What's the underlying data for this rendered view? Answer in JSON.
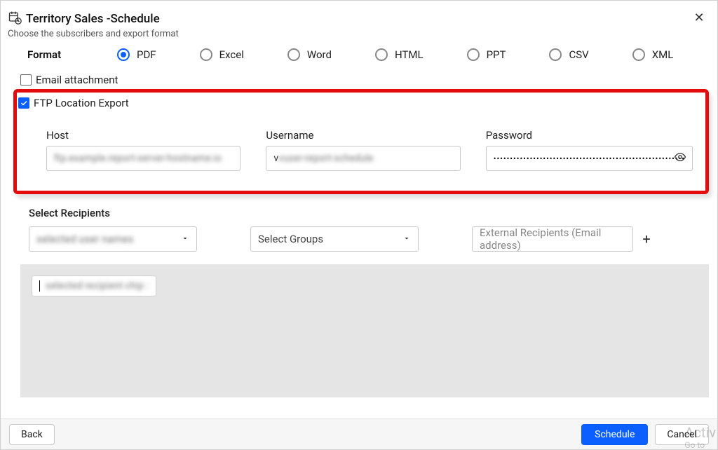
{
  "header": {
    "title": "Territory Sales -Schedule",
    "subtitle": "Choose the subscribers and export format"
  },
  "format": {
    "label": "Format",
    "options": [
      "PDF",
      "Excel",
      "Word",
      "HTML",
      "PPT",
      "CSV",
      "XML"
    ],
    "selected": "PDF"
  },
  "email_attachment": {
    "label": "Email attachment",
    "checked": false
  },
  "ftp": {
    "label": "FTP Location Export",
    "checked": true,
    "host_label": "Host",
    "host_value": "ftp.example.report-server-hostname.io",
    "username_label": "Username",
    "username_value": "vuser-report-schedule",
    "password_label": "Password",
    "password_masked": "••••••••••••••••••••••••••••••••••••••••••••••••••••••••••"
  },
  "recipients": {
    "section_label": "Select Recipients",
    "users_selected": "selected user names",
    "groups_placeholder": "Select Groups",
    "external_placeholder": "External Recipients (Email address)",
    "chip_text": "selected recipient chip :"
  },
  "footer": {
    "back": "Back",
    "schedule": "Schedule",
    "cancel": "Cancel"
  },
  "watermark": {
    "line1": "Activ",
    "line2": "Go to"
  }
}
